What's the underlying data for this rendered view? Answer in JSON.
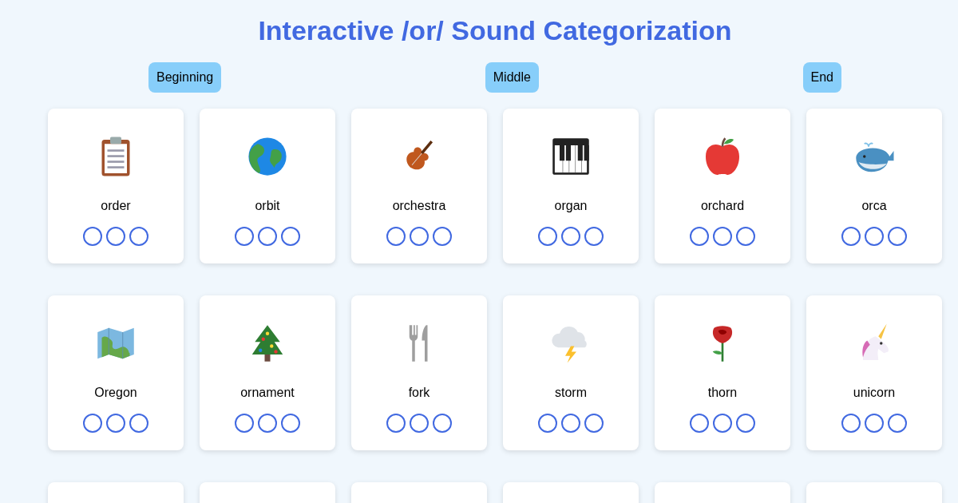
{
  "title": "Interactive /or/ Sound Categorization",
  "categories": [
    {
      "label": "Beginning"
    },
    {
      "label": "Middle"
    },
    {
      "label": "End"
    }
  ],
  "rows": [
    {
      "cards": [
        {
          "word": "order",
          "options": [
            {
              "selected": false
            },
            {
              "selected": false
            },
            {
              "selected": false
            }
          ]
        },
        {
          "word": "orbit",
          "options": [
            {
              "selected": false
            },
            {
              "selected": false
            },
            {
              "selected": false
            }
          ]
        },
        {
          "word": "orchestra",
          "options": [
            {
              "selected": false
            },
            {
              "selected": false
            },
            {
              "selected": false
            }
          ]
        },
        {
          "word": "organ",
          "options": [
            {
              "selected": false
            },
            {
              "selected": false
            },
            {
              "selected": false
            }
          ]
        },
        {
          "word": "orchard",
          "options": [
            {
              "selected": false
            },
            {
              "selected": false
            },
            {
              "selected": false
            }
          ]
        },
        {
          "word": "orca",
          "options": [
            {
              "selected": false
            },
            {
              "selected": false
            },
            {
              "selected": false
            }
          ]
        }
      ]
    },
    {
      "cards": [
        {
          "word": "Oregon",
          "options": [
            {
              "selected": false
            },
            {
              "selected": false
            },
            {
              "selected": false
            }
          ]
        },
        {
          "word": "ornament",
          "options": [
            {
              "selected": false
            },
            {
              "selected": false
            },
            {
              "selected": false
            }
          ]
        },
        {
          "word": "fork",
          "options": [
            {
              "selected": false
            },
            {
              "selected": false
            },
            {
              "selected": false
            }
          ]
        },
        {
          "word": "storm",
          "options": [
            {
              "selected": false
            },
            {
              "selected": false
            },
            {
              "selected": false
            }
          ]
        },
        {
          "word": "thorn",
          "options": [
            {
              "selected": false
            },
            {
              "selected": false
            },
            {
              "selected": false
            }
          ]
        },
        {
          "word": "unicorn",
          "options": [
            {
              "selected": false
            },
            {
              "selected": false
            },
            {
              "selected": false
            }
          ]
        }
      ]
    }
  ]
}
